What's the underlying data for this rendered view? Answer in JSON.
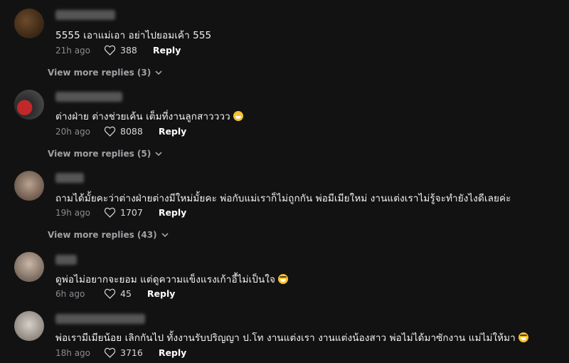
{
  "comments": [
    {
      "text": "5555 เอาแม่เอา อย่าไปยอมเค้า 555",
      "time": "21h ago",
      "likes": "388",
      "reply": "Reply",
      "view_more": "View more replies (3)",
      "emoji": ""
    },
    {
      "text": "ต่างฝ่าย ต่างช่วยเค้น เต็มที่งานลูกสาวววว",
      "time": "20h ago",
      "likes": "8088",
      "reply": "Reply",
      "view_more": "View more replies (5)",
      "emoji": "grin"
    },
    {
      "text": "ถามได้มั้ยคะว่าต่างฝ่ายต่างมีใหม่มั้ยคะ พ่อกับแม่เราก็ไม่ถูกกัน พ่อมีเมียใหม่ งานแต่งเราไม่รู้จะทำยังไงดีเลยค่ะ",
      "time": "19h ago",
      "likes": "1707",
      "reply": "Reply",
      "view_more": "View more replies (43)",
      "emoji": ""
    },
    {
      "text": "ดูพ่อไม่อยากจะยอม แต่ดูความแข็งแรงเก้าอี้ไม่เป็นใจ",
      "time": "6h ago",
      "likes": "45",
      "reply": "Reply",
      "view_more": "",
      "emoji": "laugh"
    },
    {
      "text": "พ่อเรามีเมียน้อย เลิกกันไป ทั้งงานรับปริญญา ป.โท งานแต่งเรา งานแต่งน้องสาว พ่อไม่ได้มาซักงาน แม่ไม่ให้มา",
      "time": "18h ago",
      "likes": "3716",
      "reply": "Reply",
      "view_more": "",
      "emoji": "laugh"
    }
  ],
  "colors": {
    "background": "#121212",
    "text": "#f1f1f1",
    "meta": "#8a8b91",
    "accent_emoji": "#f6c230"
  }
}
